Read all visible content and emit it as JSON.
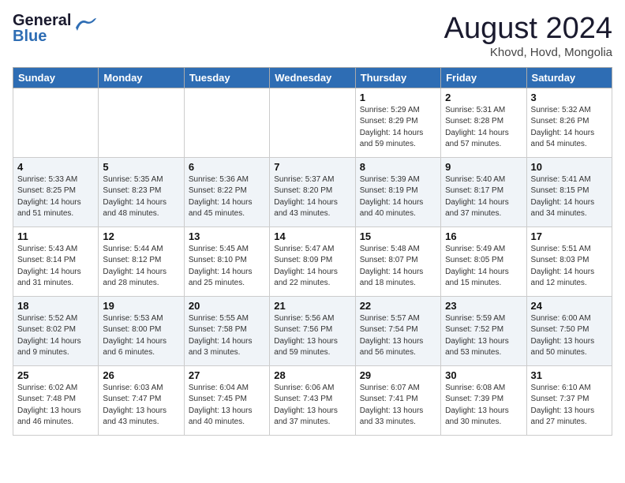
{
  "header": {
    "logo_general": "General",
    "logo_blue": "Blue",
    "month_title": "August 2024",
    "location": "Khovd, Hovd, Mongolia"
  },
  "weekdays": [
    "Sunday",
    "Monday",
    "Tuesday",
    "Wednesday",
    "Thursday",
    "Friday",
    "Saturday"
  ],
  "weeks": [
    [
      {
        "day": "",
        "detail": ""
      },
      {
        "day": "",
        "detail": ""
      },
      {
        "day": "",
        "detail": ""
      },
      {
        "day": "",
        "detail": ""
      },
      {
        "day": "1",
        "detail": "Sunrise: 5:29 AM\nSunset: 8:29 PM\nDaylight: 14 hours\nand 59 minutes."
      },
      {
        "day": "2",
        "detail": "Sunrise: 5:31 AM\nSunset: 8:28 PM\nDaylight: 14 hours\nand 57 minutes."
      },
      {
        "day": "3",
        "detail": "Sunrise: 5:32 AM\nSunset: 8:26 PM\nDaylight: 14 hours\nand 54 minutes."
      }
    ],
    [
      {
        "day": "4",
        "detail": "Sunrise: 5:33 AM\nSunset: 8:25 PM\nDaylight: 14 hours\nand 51 minutes."
      },
      {
        "day": "5",
        "detail": "Sunrise: 5:35 AM\nSunset: 8:23 PM\nDaylight: 14 hours\nand 48 minutes."
      },
      {
        "day": "6",
        "detail": "Sunrise: 5:36 AM\nSunset: 8:22 PM\nDaylight: 14 hours\nand 45 minutes."
      },
      {
        "day": "7",
        "detail": "Sunrise: 5:37 AM\nSunset: 8:20 PM\nDaylight: 14 hours\nand 43 minutes."
      },
      {
        "day": "8",
        "detail": "Sunrise: 5:39 AM\nSunset: 8:19 PM\nDaylight: 14 hours\nand 40 minutes."
      },
      {
        "day": "9",
        "detail": "Sunrise: 5:40 AM\nSunset: 8:17 PM\nDaylight: 14 hours\nand 37 minutes."
      },
      {
        "day": "10",
        "detail": "Sunrise: 5:41 AM\nSunset: 8:15 PM\nDaylight: 14 hours\nand 34 minutes."
      }
    ],
    [
      {
        "day": "11",
        "detail": "Sunrise: 5:43 AM\nSunset: 8:14 PM\nDaylight: 14 hours\nand 31 minutes."
      },
      {
        "day": "12",
        "detail": "Sunrise: 5:44 AM\nSunset: 8:12 PM\nDaylight: 14 hours\nand 28 minutes."
      },
      {
        "day": "13",
        "detail": "Sunrise: 5:45 AM\nSunset: 8:10 PM\nDaylight: 14 hours\nand 25 minutes."
      },
      {
        "day": "14",
        "detail": "Sunrise: 5:47 AM\nSunset: 8:09 PM\nDaylight: 14 hours\nand 22 minutes."
      },
      {
        "day": "15",
        "detail": "Sunrise: 5:48 AM\nSunset: 8:07 PM\nDaylight: 14 hours\nand 18 minutes."
      },
      {
        "day": "16",
        "detail": "Sunrise: 5:49 AM\nSunset: 8:05 PM\nDaylight: 14 hours\nand 15 minutes."
      },
      {
        "day": "17",
        "detail": "Sunrise: 5:51 AM\nSunset: 8:03 PM\nDaylight: 14 hours\nand 12 minutes."
      }
    ],
    [
      {
        "day": "18",
        "detail": "Sunrise: 5:52 AM\nSunset: 8:02 PM\nDaylight: 14 hours\nand 9 minutes."
      },
      {
        "day": "19",
        "detail": "Sunrise: 5:53 AM\nSunset: 8:00 PM\nDaylight: 14 hours\nand 6 minutes."
      },
      {
        "day": "20",
        "detail": "Sunrise: 5:55 AM\nSunset: 7:58 PM\nDaylight: 14 hours\nand 3 minutes."
      },
      {
        "day": "21",
        "detail": "Sunrise: 5:56 AM\nSunset: 7:56 PM\nDaylight: 13 hours\nand 59 minutes."
      },
      {
        "day": "22",
        "detail": "Sunrise: 5:57 AM\nSunset: 7:54 PM\nDaylight: 13 hours\nand 56 minutes."
      },
      {
        "day": "23",
        "detail": "Sunrise: 5:59 AM\nSunset: 7:52 PM\nDaylight: 13 hours\nand 53 minutes."
      },
      {
        "day": "24",
        "detail": "Sunrise: 6:00 AM\nSunset: 7:50 PM\nDaylight: 13 hours\nand 50 minutes."
      }
    ],
    [
      {
        "day": "25",
        "detail": "Sunrise: 6:02 AM\nSunset: 7:48 PM\nDaylight: 13 hours\nand 46 minutes."
      },
      {
        "day": "26",
        "detail": "Sunrise: 6:03 AM\nSunset: 7:47 PM\nDaylight: 13 hours\nand 43 minutes."
      },
      {
        "day": "27",
        "detail": "Sunrise: 6:04 AM\nSunset: 7:45 PM\nDaylight: 13 hours\nand 40 minutes."
      },
      {
        "day": "28",
        "detail": "Sunrise: 6:06 AM\nSunset: 7:43 PM\nDaylight: 13 hours\nand 37 minutes."
      },
      {
        "day": "29",
        "detail": "Sunrise: 6:07 AM\nSunset: 7:41 PM\nDaylight: 13 hours\nand 33 minutes."
      },
      {
        "day": "30",
        "detail": "Sunrise: 6:08 AM\nSunset: 7:39 PM\nDaylight: 13 hours\nand 30 minutes."
      },
      {
        "day": "31",
        "detail": "Sunrise: 6:10 AM\nSunset: 7:37 PM\nDaylight: 13 hours\nand 27 minutes."
      }
    ]
  ]
}
